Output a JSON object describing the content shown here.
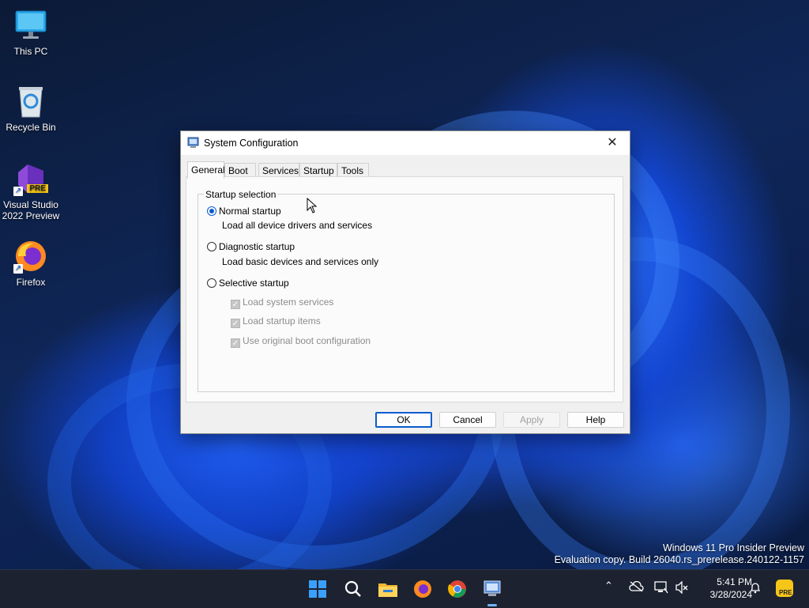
{
  "desktop": {
    "icons": [
      {
        "label": "This PC",
        "icon": "monitor-icon"
      },
      {
        "label": "Recycle Bin",
        "icon": "recycle-bin-icon"
      },
      {
        "label": "Visual Studio\n2022 Preview",
        "label_line1": "Visual Studio",
        "label_line2": "2022 Preview",
        "badge": "PRE",
        "icon": "visual-studio-icon"
      },
      {
        "label": "Firefox",
        "icon": "firefox-icon"
      }
    ]
  },
  "dialog": {
    "title": "System Configuration",
    "tabs": [
      "General",
      "Boot",
      "Services",
      "Startup",
      "Tools"
    ],
    "active_tab": "General",
    "group_label": "Startup selection",
    "options": [
      {
        "label": "Normal startup",
        "description": "Load all device drivers and services",
        "checked": true
      },
      {
        "label": "Diagnostic startup",
        "description": "Load basic devices and services only",
        "checked": false
      },
      {
        "label": "Selective startup",
        "checked": false
      }
    ],
    "selective_items": [
      "Load system services",
      "Load startup items",
      "Use original boot configuration"
    ],
    "buttons": {
      "ok": "OK",
      "cancel": "Cancel",
      "apply": "Apply",
      "help": "Help"
    },
    "close_glyph": "✕"
  },
  "watermark": {
    "line1": "Windows 11 Pro Insider Preview",
    "line2": "Evaluation copy. Build 26040.rs_prerelease.240122-1157"
  },
  "taskbar": {
    "time": "5:41 PM",
    "date": "3/28/2024",
    "badge": "PRE",
    "accent": "#0a5bd0"
  }
}
